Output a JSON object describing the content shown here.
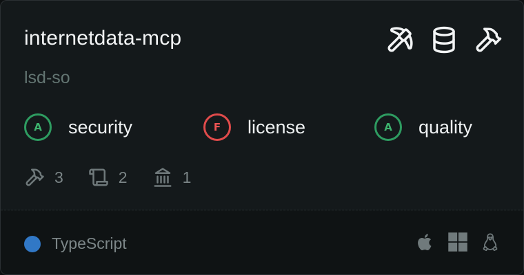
{
  "server": {
    "name": "internetdata-mcp",
    "owner": "lsd-so"
  },
  "capabilities": [
    "pickaxe-icon",
    "database-icon",
    "hammer-icon"
  ],
  "scores": [
    {
      "grade": "A",
      "label": "security",
      "color": "#3db36e"
    },
    {
      "grade": "F",
      "label": "license",
      "color": "#f05454"
    },
    {
      "grade": "A",
      "label": "quality",
      "color": "#3db36e"
    }
  ],
  "stats": {
    "tools": "3",
    "prompts": "2",
    "resources": "1"
  },
  "footer": {
    "language": "TypeScript",
    "language_color": "#3178c6",
    "platforms": [
      "apple-icon",
      "windows-icon",
      "linux-icon"
    ]
  }
}
